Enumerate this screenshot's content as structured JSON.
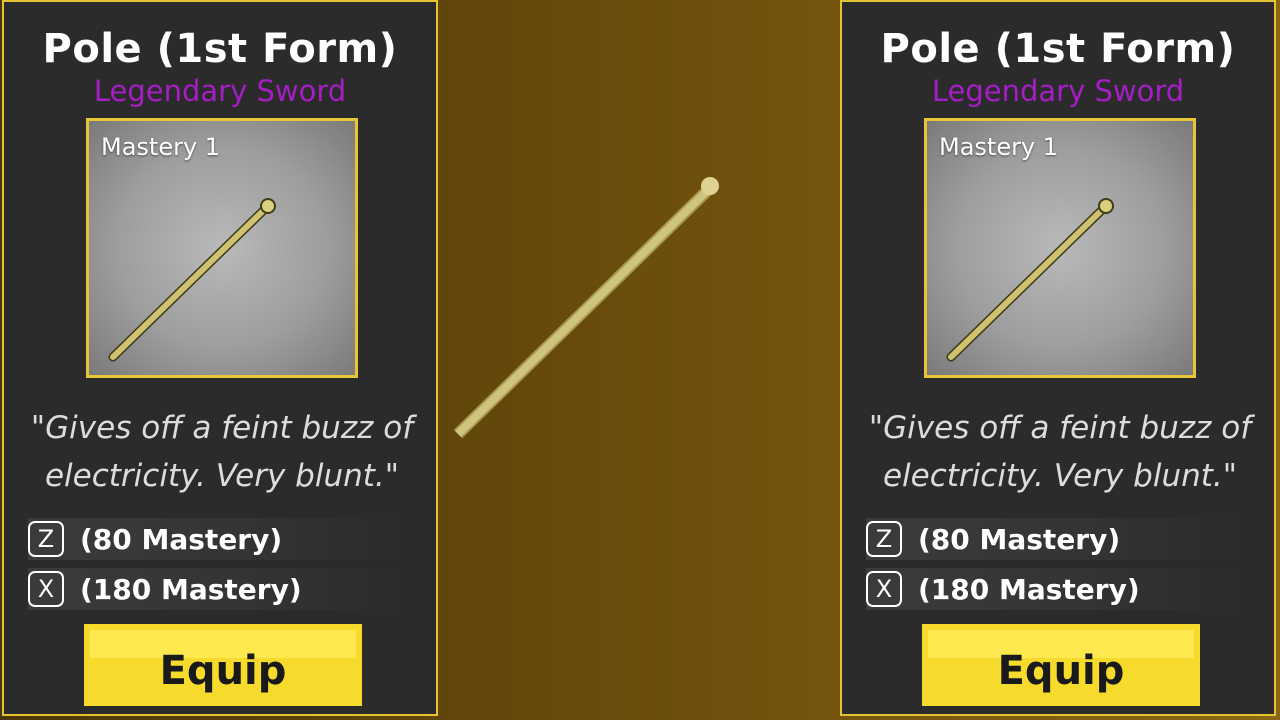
{
  "cards": [
    {
      "title": "Pole (1st Form)",
      "rarity": "Legendary Sword",
      "mastery": "Mastery 1",
      "description_line1": "\"Gives off a feint buzz of",
      "description_line2": "electricity. Very blunt.\"",
      "moves": [
        {
          "key": "Z",
          "text": "(80 Mastery)"
        },
        {
          "key": "X",
          "text": "(180 Mastery)"
        }
      ],
      "equip_label": "Equip"
    },
    {
      "title": "Pole (1st Form)",
      "rarity": "Legendary Sword",
      "mastery": "Mastery 1",
      "description_line1": "\"Gives off a feint buzz of",
      "description_line2": "electricity. Very blunt.\"",
      "moves": [
        {
          "key": "Z",
          "text": "(80 Mastery)"
        },
        {
          "key": "X",
          "text": "(180 Mastery)"
        }
      ],
      "equip_label": "Equip"
    }
  ],
  "colors": {
    "border": "#e5c431",
    "rarity": "#a41ec4",
    "equip": "#f6db2c",
    "panel": "#2b2b2b"
  },
  "icons": {
    "weapon": "pole-icon",
    "center_model": "pole-model"
  }
}
